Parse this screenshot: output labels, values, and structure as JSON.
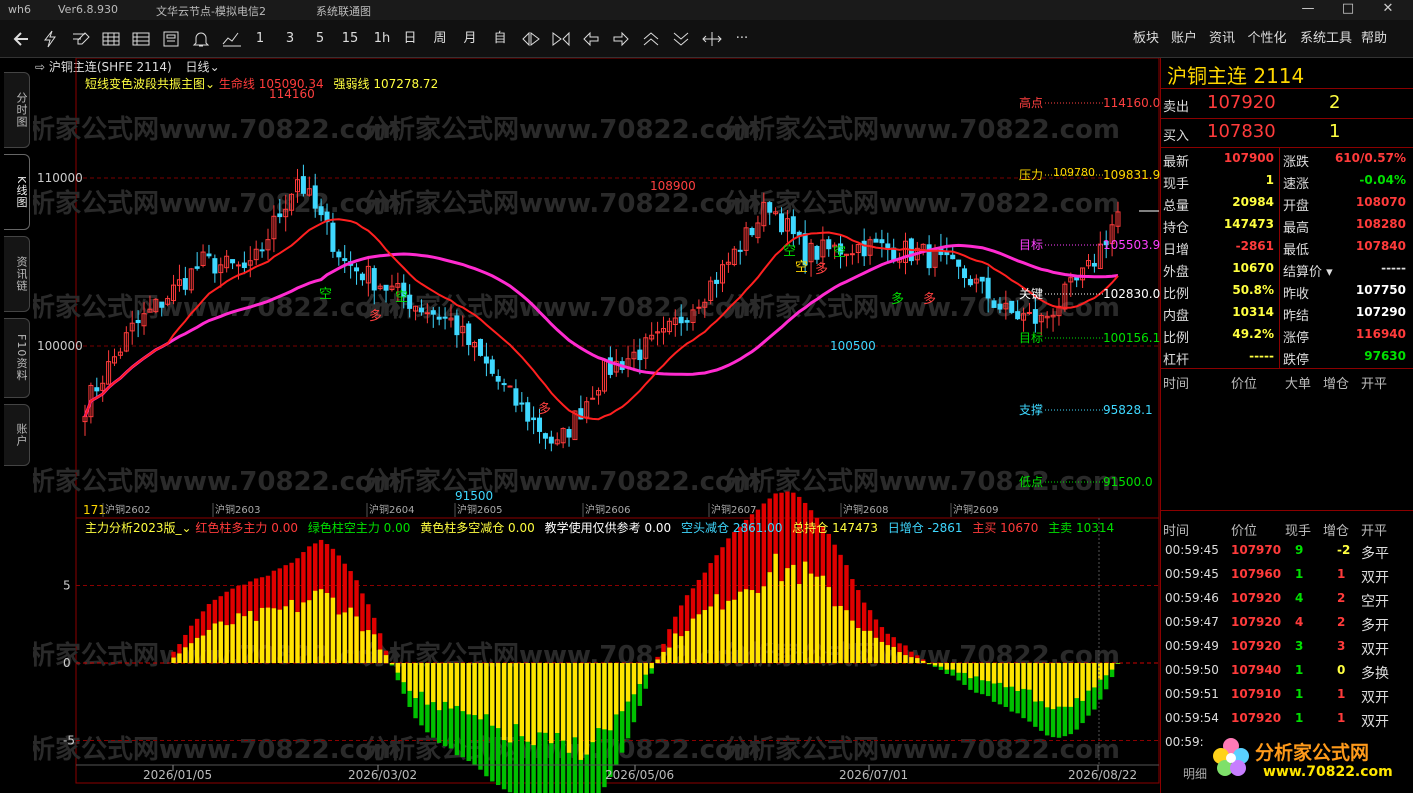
{
  "window": {
    "app": "wh6",
    "version": "Ver6.8.930",
    "title": "文华云节点-模拟电信2",
    "notice": "系统联通图",
    "min": "—",
    "max": "□",
    "close": "✕"
  },
  "toolbar": {
    "icons": [
      "back-icon",
      "flash-icon",
      "draw-icon",
      "grid-icon",
      "list-icon",
      "window-icon",
      "bell-icon",
      "line-icon"
    ],
    "periods": [
      "1",
      "3",
      "5",
      "15",
      "1h",
      "日",
      "周",
      "月",
      "自"
    ],
    "nav_icons": [
      "diamond-left-icon",
      "diamond-right-icon",
      "arrow-left-icon",
      "arrow-right-icon",
      "chevron-up-icon",
      "chevron-down-icon",
      "crosshair-icon"
    ],
    "more": "···",
    "menu": [
      "板块",
      "账户",
      "资讯",
      "个性化",
      "系统工具",
      "帮助"
    ]
  },
  "sidetabs": [
    "分时图",
    "K线图",
    "资讯链",
    "F10资料",
    "账户"
  ],
  "chart": {
    "contract": "沪铜主连(SHFE 2114)",
    "period": "日线",
    "indicator": "短线变色波段共振主图",
    "life_label": "生命线",
    "life_value": "105090.34",
    "strong_label": "强弱线",
    "strong_value": "107278.72",
    "y_labels": [
      "110000",
      "100000"
    ],
    "high_mark": "114160",
    "low_mark": "91500",
    "peak2": "108900",
    "trough2": "100500",
    "start_val": "171",
    "bar_start": "1/1",
    "levels": [
      {
        "name": "高点",
        "value": "114160.0",
        "color": "#ff4040"
      },
      {
        "name": "压力",
        "value": "109831.9",
        "color": "#ffd700"
      },
      {
        "name": "目标",
        "value": "105503.9",
        "color": "#ff40ff"
      },
      {
        "name": "关键",
        "value": "102830.0",
        "color": "#ffffff"
      },
      {
        "name": "目标",
        "value": "100156.1",
        "color": "#00e000"
      },
      {
        "name": "支撑",
        "value": "95828.1",
        "color": "#3fd8ff"
      },
      {
        "name": "低点",
        "value": "91500.0",
        "color": "#00e000"
      }
    ],
    "pressure_tag": "109780",
    "contracts": [
      "沪铜2602",
      "沪铜2603",
      "沪铜2604",
      "沪铜2605",
      "沪铜2606",
      "沪铜2607",
      "沪铜2608",
      "沪铜2609"
    ],
    "signals": [
      "空",
      "多",
      "空",
      "空",
      "多",
      "空",
      "多",
      "多",
      "空",
      "多"
    ],
    "dates": [
      "2026/01/05",
      "2026/03/02",
      "2026/05/06",
      "2026/07/01",
      "2026/08/22"
    ]
  },
  "sub": {
    "name": "主力分析2023版_",
    "items": [
      {
        "label": "红色柱多主力",
        "value": "0.00",
        "color": "#ff3b3b"
      },
      {
        "label": "绿色柱空主力",
        "value": "0.00",
        "color": "#00e000"
      },
      {
        "label": "黄色柱多空减仓",
        "value": "0.00",
        "color": "#ffff40"
      },
      {
        "label": "教学使用仅供参考",
        "value": "0.00",
        "color": "#ffffff"
      },
      {
        "label": "空头减仓",
        "value": "2861.00",
        "color": "#3fd8ff"
      },
      {
        "label": "总持仓",
        "value": "147473",
        "color": "#ffff40"
      },
      {
        "label": "日增仓",
        "value": "-2861",
        "color": "#3fd8ff"
      },
      {
        "label": "主买",
        "value": "10670",
        "color": "#ff3b3b"
      },
      {
        "label": "主卖",
        "value": "10314",
        "color": "#00e000"
      }
    ],
    "y_labels": [
      "5",
      "0",
      "-5"
    ]
  },
  "quote": {
    "title": "沪铜主连",
    "code": "2114",
    "sell_label": "卖出",
    "sell_price": "107920",
    "sell_vol": "2",
    "buy_label": "买入",
    "buy_price": "107830",
    "buy_vol": "1",
    "rows": [
      [
        "最新",
        "107900",
        "涨跌",
        "610/0.57%"
      ],
      [
        "现手",
        "1",
        "速涨",
        "-0.04%"
      ],
      [
        "总量",
        "20984",
        "开盘",
        "108070"
      ],
      [
        "持仓",
        "147473",
        "最高",
        "108280"
      ],
      [
        "日增",
        "-2861",
        "最低",
        "107840"
      ],
      [
        "外盘",
        "10670",
        "结算价",
        "-----"
      ],
      [
        "比例",
        "50.8%",
        "昨收",
        "107750"
      ],
      [
        "内盘",
        "10314",
        "昨结",
        "107290"
      ],
      [
        "比例",
        "49.2%",
        "涨停",
        "116940"
      ],
      [
        "杠杆",
        "-----",
        "跌停",
        "97630"
      ]
    ],
    "tbl1": [
      "时间",
      "价位",
      "大单",
      "增仓",
      "开平"
    ],
    "tbl2": [
      "时间",
      "价位",
      "现手",
      "增仓",
      "开平"
    ],
    "ticks": [
      [
        "00:59:45",
        "107970",
        "9",
        "-2",
        "多平"
      ],
      [
        "00:59:45",
        "107960",
        "1",
        "1",
        "双开"
      ],
      [
        "00:59:46",
        "107920",
        "4",
        "2",
        "空开"
      ],
      [
        "00:59:47",
        "107920",
        "4",
        "2",
        "多开"
      ],
      [
        "00:59:49",
        "107920",
        "3",
        "3",
        "双开"
      ],
      [
        "00:59:50",
        "107940",
        "1",
        "0",
        "多换"
      ],
      [
        "00:59:51",
        "107910",
        "1",
        "1",
        "双开"
      ],
      [
        "00:59:54",
        "107920",
        "1",
        "1",
        "双开"
      ],
      [
        "00:59:",
        "",
        "",
        "",
        ""
      ]
    ],
    "footer": "明细"
  },
  "watermark": {
    "text": "分析家公式网www.70822.com",
    "logo_title": "分析家公式网",
    "logo_url": "www.70822.com"
  }
}
